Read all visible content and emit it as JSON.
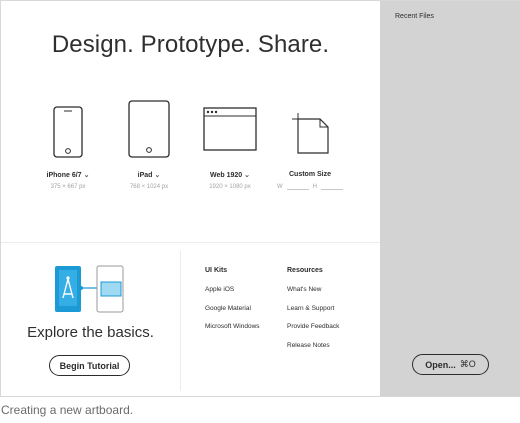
{
  "window": {
    "headline": "Design. Prototype. Share."
  },
  "presets": [
    {
      "name": "iPhone 6/7",
      "dims": "375 × 667 px",
      "icon": "phone-icon"
    },
    {
      "name": "iPad",
      "dims": "768 × 1024 px",
      "icon": "tablet-icon"
    },
    {
      "name": "Web 1920",
      "dims": "1920 × 1080 px",
      "icon": "browser-window-icon"
    },
    {
      "name": "Custom Size",
      "w_label": "W",
      "h_label": "H",
      "icon": "custom-artboard-icon"
    }
  ],
  "chevron": "⌄",
  "tutorial": {
    "heading": "Explore the basics.",
    "button": "Begin Tutorial"
  },
  "ui_kits": {
    "title": "UI Kits",
    "links": [
      "Apple iOS",
      "Google Material",
      "Microsoft Windows"
    ]
  },
  "resources": {
    "title": "Resources",
    "links": [
      "What's New",
      "Learn & Support",
      "Provide Feedback",
      "Release Notes"
    ]
  },
  "sidebar": {
    "title": "Recent Files",
    "open_label": "Open...",
    "open_shortcut": "⌘O"
  },
  "caption": "Creating a new artboard.",
  "colors": {
    "accent_blue": "#1c9ad6",
    "sidebar_bg": "#d3d3d3"
  }
}
